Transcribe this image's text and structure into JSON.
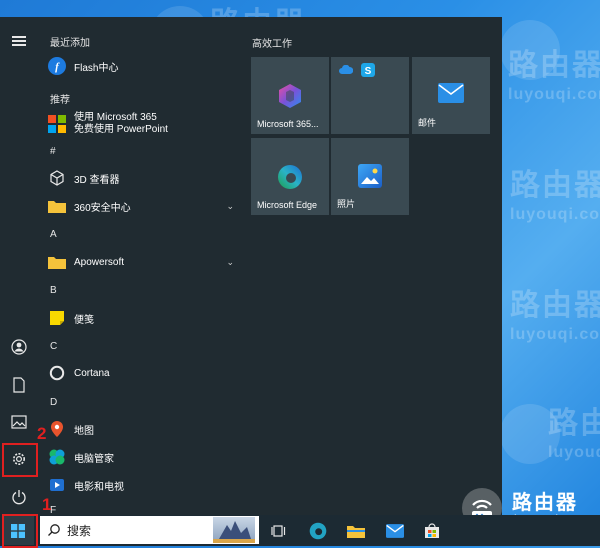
{
  "watermark": {
    "text": "路由器",
    "subtext": "luyouqi.com"
  },
  "start_menu": {
    "recent_header": "最近添加",
    "recommended_header": "推荐",
    "tiles_header": "高效工作",
    "apps": [
      {
        "label": "Flash中心",
        "icon": "flash-icon"
      },
      {
        "label": "使用 Microsoft 365\n免费使用 PowerPoint",
        "icon": "office-icon"
      },
      {
        "label": "#",
        "icon": ""
      },
      {
        "label": "3D 查看器",
        "icon": "cube-icon"
      },
      {
        "label": "360安全中心",
        "icon": "folder-icon",
        "expandable": true
      },
      {
        "label": "A",
        "icon": ""
      },
      {
        "label": "Apowersoft",
        "icon": "folder-icon",
        "expandable": true
      },
      {
        "label": "B",
        "icon": ""
      },
      {
        "label": "便笺",
        "icon": "sticky-notes-icon"
      },
      {
        "label": "C",
        "icon": ""
      },
      {
        "label": "Cortana",
        "icon": "cortana-icon"
      },
      {
        "label": "D",
        "icon": ""
      },
      {
        "label": "地图",
        "icon": "maps-icon"
      },
      {
        "label": "电脑管家",
        "icon": "pc-manager-icon"
      },
      {
        "label": "电影和电视",
        "icon": "movies-icon"
      },
      {
        "label": "F",
        "icon": ""
      }
    ],
    "tiles": [
      {
        "label": "Microsoft 365...",
        "icon": "m365-icon"
      },
      {
        "label": "",
        "icon": "onedrive-skype-icon"
      },
      {
        "label": "邮件",
        "icon": "mail-icon"
      },
      {
        "label": "Microsoft Edge",
        "icon": "edge-icon"
      },
      {
        "label": "照片",
        "icon": "photos-icon"
      }
    ]
  },
  "annotations": {
    "step1": "1",
    "step2": "2"
  },
  "taskbar": {
    "search_label": "搜索"
  },
  "colors": {
    "menu_bg": "#202b31",
    "tile_bg": "#3a4a52",
    "annotation_red": "#e02020",
    "desktop_blue": "#2a8fe6"
  }
}
